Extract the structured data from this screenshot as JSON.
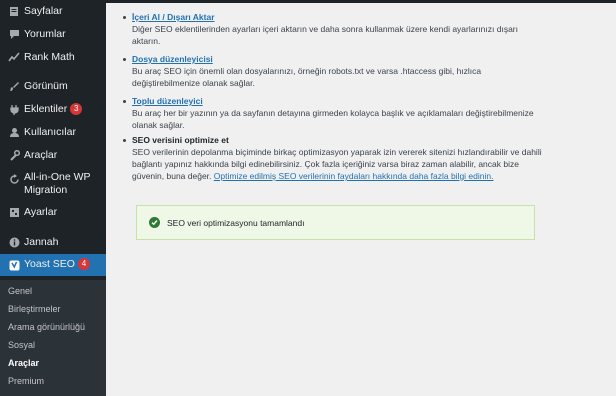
{
  "sidebar": {
    "items": [
      {
        "label": "Sayfalar",
        "icon": "pages-icon"
      },
      {
        "label": "Yorumlar",
        "icon": "comments-icon"
      },
      {
        "label": "Rank Math",
        "icon": "rank-math-icon"
      },
      {
        "label": "Görünüm",
        "icon": "appearance-icon"
      },
      {
        "label": "Eklentiler",
        "icon": "plugins-icon",
        "badge": "3"
      },
      {
        "label": "Kullanıcılar",
        "icon": "users-icon"
      },
      {
        "label": "Araçlar",
        "icon": "tools-icon"
      },
      {
        "label": "All-in-One WP",
        "label2": "Migration",
        "icon": "migration-icon"
      },
      {
        "label": "Ayarlar",
        "icon": "settings-icon"
      },
      {
        "label": "Jannah",
        "icon": "jannah-icon"
      },
      {
        "label": "Yoast SEO",
        "icon": "yoast-icon",
        "badge": "4",
        "active": true
      }
    ],
    "submenu": [
      "Genel",
      "Birleştirmeler",
      "Arama görünürlüğü",
      "Sosyal",
      "Araçlar",
      "Premium"
    ],
    "submenu_current": "Araçlar"
  },
  "main": {
    "import_export": {
      "link": "İçeri Al / Dışarı Aktar",
      "desc": "Diğer SEO eklentilerinden ayarları içeri aktarın ve daha sonra kullanmak üzere kendi ayarlarınızı dışarı aktarın."
    },
    "file_editor": {
      "link": "Dosya düzenleyicisi",
      "desc": "Bu araç SEO için önemli olan dosyalarınızı, örneğin robots.txt ve varsa .htaccess gibi, hızlıca değiştirebilmenize olanak sağlar."
    },
    "bulk_editor": {
      "link": "Toplu düzenleyici",
      "desc": "Bu araç her bir yazının ya da sayfanın detayına girmeden kolayca başlık ve açıklamaları değiştirebilmenize olanak sağlar."
    },
    "seo_optimize": {
      "title": "SEO verisini optimize et",
      "desc": "SEO verilerinin depolanma biçiminde birkaç optimizasyon yaparak izin vererek sitenizi hızlandırabilir ve dahili bağlantı yapınız hakkında bilgi edinebilirsiniz. Çok fazla içeriğiniz varsa biraz zaman alabilir, ancak bize güvenin, buna değer.",
      "link": "Optimize edilmiş SEO verilerinin faydaları hakkında daha fazla bilgi edinin."
    },
    "notice": {
      "text": "SEO veri optimizasyonu tamamlandı",
      "color": "#2d7a35"
    }
  }
}
